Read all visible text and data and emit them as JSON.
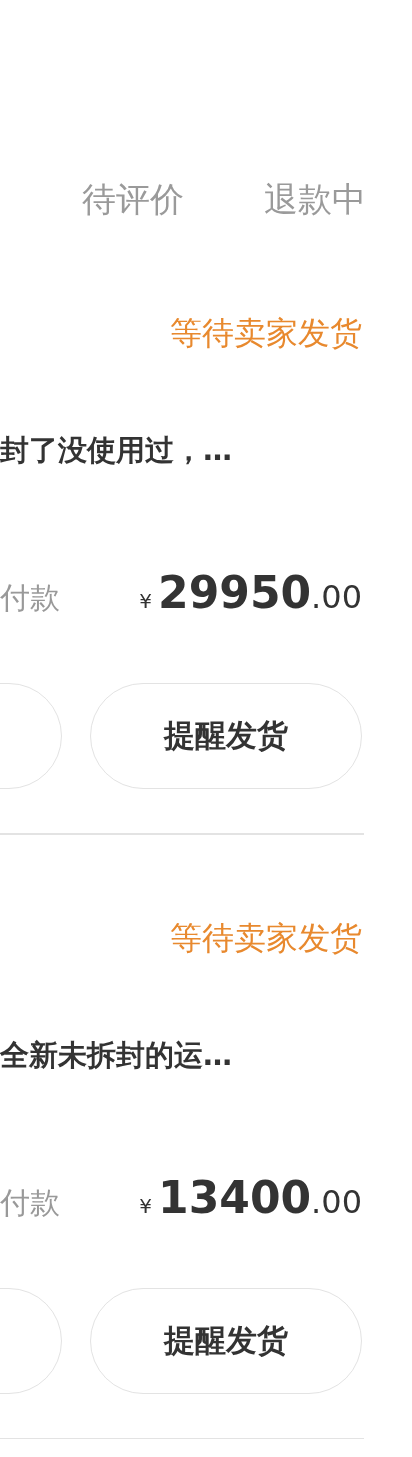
{
  "tabs": [
    {
      "label": "待评价"
    },
    {
      "label": "退款中"
    }
  ],
  "orders": [
    {
      "status": "等待卖家发货",
      "title": "封了没使用过，…",
      "price_label": "付款",
      "currency": "¥",
      "amount_integer": "29950",
      "amount_decimal": ".00",
      "buttons": [
        {
          "kind": "partial"
        },
        {
          "kind": "full",
          "label": "提醒发货"
        }
      ]
    },
    {
      "status": "等待卖家发货",
      "title": "全新未拆封的运…",
      "price_label": "付款",
      "currency": "¥",
      "amount_integer": "13400",
      "amount_decimal": ".00",
      "buttons": [
        {
          "kind": "partial"
        },
        {
          "kind": "full",
          "label": "提醒发货"
        }
      ]
    }
  ]
}
